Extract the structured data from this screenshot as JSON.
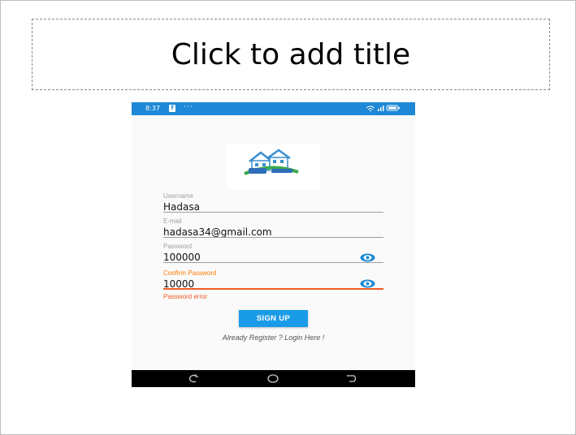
{
  "slide": {
    "title_placeholder": "Click to add title"
  },
  "phone": {
    "status_bar": {
      "time": "8:37",
      "app_icon": "facebook-icon",
      "dots": "···",
      "right_icons": "wifi-signal-battery-icons"
    },
    "logo": {
      "icon": "house-logo-icon"
    },
    "form": {
      "username": {
        "label": "Username",
        "value": "Hadasa"
      },
      "email": {
        "label": "E-mail",
        "value": "hadasa34@gmail.com"
      },
      "password": {
        "label": "Password",
        "value": "100000"
      },
      "confirm_password": {
        "label": "Confirm Password",
        "value": "10000"
      },
      "error": "Password error"
    },
    "signup_label": "SIGN UP",
    "login_link": "Already Register ? Login Here !",
    "nav_bar": {
      "buttons": [
        "recent-apps-icon",
        "home-icon",
        "back-icon"
      ]
    },
    "colors": {
      "status_bar": "#1e88d6",
      "button": "#1a9be8",
      "error": "#f15a24",
      "label_error": "#ff7a00",
      "eye": "#1a8ad4"
    }
  }
}
